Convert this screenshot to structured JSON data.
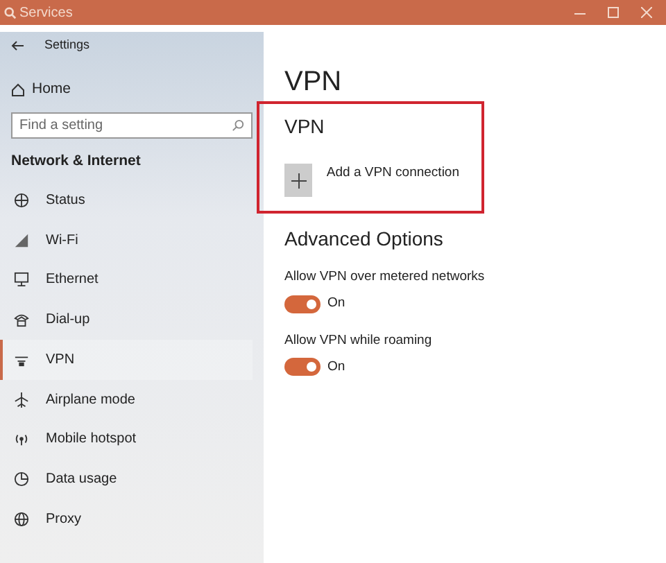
{
  "window": {
    "title": "Services"
  },
  "sidebar": {
    "title": "Settings",
    "home": "Home",
    "search": {
      "placeholder": "Find a setting"
    },
    "section": "Network & Internet",
    "items": [
      {
        "label": "Status",
        "selected": false
      },
      {
        "label": "Wi-Fi",
        "selected": false
      },
      {
        "label": "Ethernet",
        "selected": false
      },
      {
        "label": "Dial-up",
        "selected": false
      },
      {
        "label": "VPN",
        "selected": true
      },
      {
        "label": "Airplane mode",
        "selected": false
      },
      {
        "label": "Mobile hotspot",
        "selected": false
      },
      {
        "label": "Data usage",
        "selected": false
      },
      {
        "label": "Proxy",
        "selected": false
      }
    ]
  },
  "main": {
    "title": "VPN",
    "vpn_section": {
      "title": "VPN",
      "add_label": "Add a VPN connection",
      "highlighted": true
    },
    "advanced_title": "Advanced Options",
    "options": [
      {
        "label": "Allow VPN over metered networks",
        "on": true,
        "state": "On"
      },
      {
        "label": "Allow VPN while roaming",
        "on": true,
        "state": "On"
      }
    ]
  }
}
